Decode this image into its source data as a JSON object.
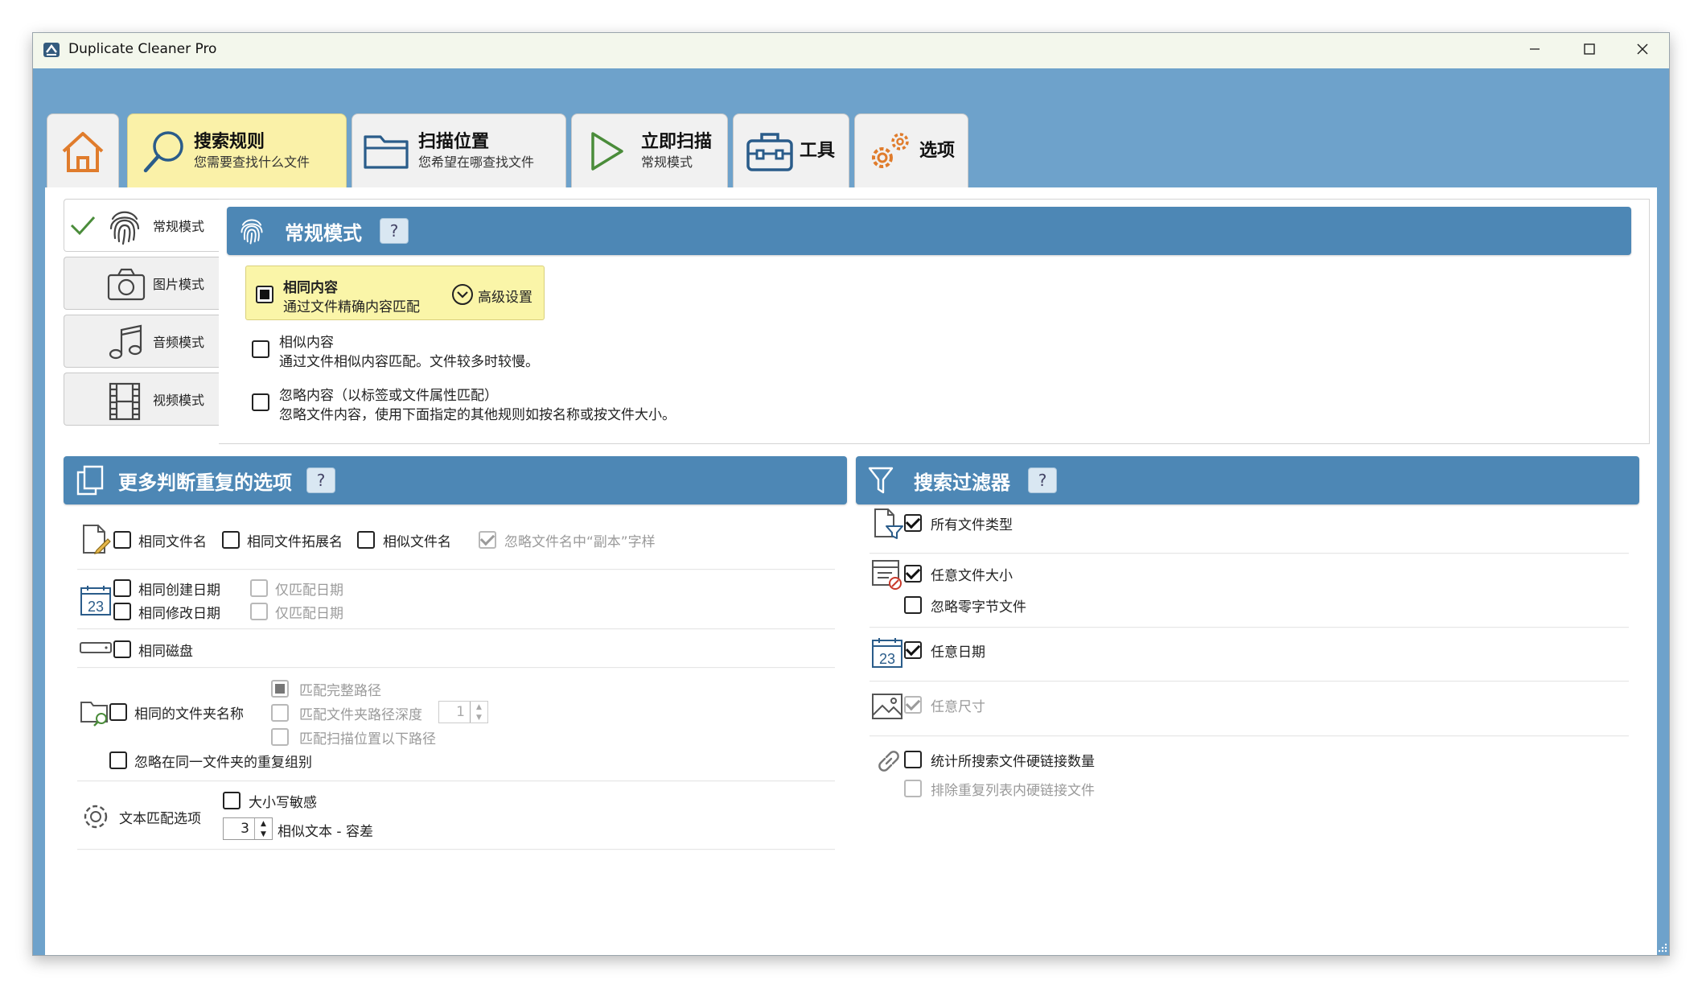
{
  "window": {
    "title": "Duplicate Cleaner Pro"
  },
  "tabs": [
    {
      "id": "home",
      "title": "",
      "subtitle": ""
    },
    {
      "id": "search-rules",
      "title": "搜索规则",
      "subtitle": "您需要查找什么文件"
    },
    {
      "id": "scan-location",
      "title": "扫描位置",
      "subtitle": "您希望在哪查找文件"
    },
    {
      "id": "scan-now",
      "title": "立即扫描",
      "subtitle": "常规模式"
    },
    {
      "id": "tools",
      "title": "工具",
      "subtitle": ""
    },
    {
      "id": "options",
      "title": "选项",
      "subtitle": ""
    }
  ],
  "modes": [
    {
      "label": "常规模式",
      "selected": true,
      "icon": "fingerprint-icon"
    },
    {
      "label": "图片模式",
      "selected": false,
      "icon": "camera-icon"
    },
    {
      "label": "音频模式",
      "selected": false,
      "icon": "music-note-icon"
    },
    {
      "label": "视频模式",
      "selected": false,
      "icon": "film-icon"
    }
  ],
  "normal_mode": {
    "title": "常规模式",
    "help": "?",
    "options": [
      {
        "title": "相同内容",
        "desc": "通过文件精确内容匹配",
        "checked": true
      },
      {
        "title": "相似内容",
        "desc": "通过文件相似内容匹配。文件较多时较慢。",
        "checked": false
      },
      {
        "title": "忽略内容（以标签或文件属性匹配）",
        "desc": "忽略文件内容，使用下面指定的其他规则如按名称或按文件大小。",
        "checked": false
      }
    ],
    "advanced_label": "高级设置"
  },
  "more_options": {
    "title": "更多判断重复的选项",
    "help": "?",
    "same_filename": "相同文件名",
    "same_extension": "相同文件拓展名",
    "similar_filename": "相似文件名",
    "ignore_copy": "忽略文件名中“副本”字样",
    "same_created": "相同创建日期",
    "same_modified": "相同修改日期",
    "date_only_1": "仅匹配日期",
    "date_only_2": "仅匹配日期",
    "same_disk": "相同磁盘",
    "match_full_path": "匹配完整路径",
    "same_folder_name": "相同的文件夹名称",
    "match_folder_depth": "匹配文件夹路径深度",
    "folder_depth_value": "1",
    "match_below_scan": "匹配扫描位置以下路径",
    "ignore_same_folder": "忽略在同一文件夹的重复组别",
    "text_match_options": "文本匹配选项",
    "case_sensitive": "大小写敏感",
    "similar_text_value": "3",
    "similar_text_tolerance": "相似文本 - 容差",
    "calendar_day": "23"
  },
  "filters": {
    "title": "搜索过滤器",
    "help": "?",
    "all_file_types": "所有文件类型",
    "any_file_size": "任意文件大小",
    "ignore_zero_byte": "忽略零字节文件",
    "any_date": "任意日期",
    "any_dimension": "任意尺寸",
    "count_hardlinks": "统计所搜索文件硬链接数量",
    "exclude_hardlinks": "排除重复列表内硬链接文件",
    "calendar_day": "23"
  },
  "colors": {
    "accent": "#4d87b5",
    "frame": "#6ea2cb",
    "active_tab": "#faf1a8",
    "titlebar": "#f3f7ec",
    "home_orange": "#e07c2c",
    "check_green": "#4a8c3a"
  }
}
